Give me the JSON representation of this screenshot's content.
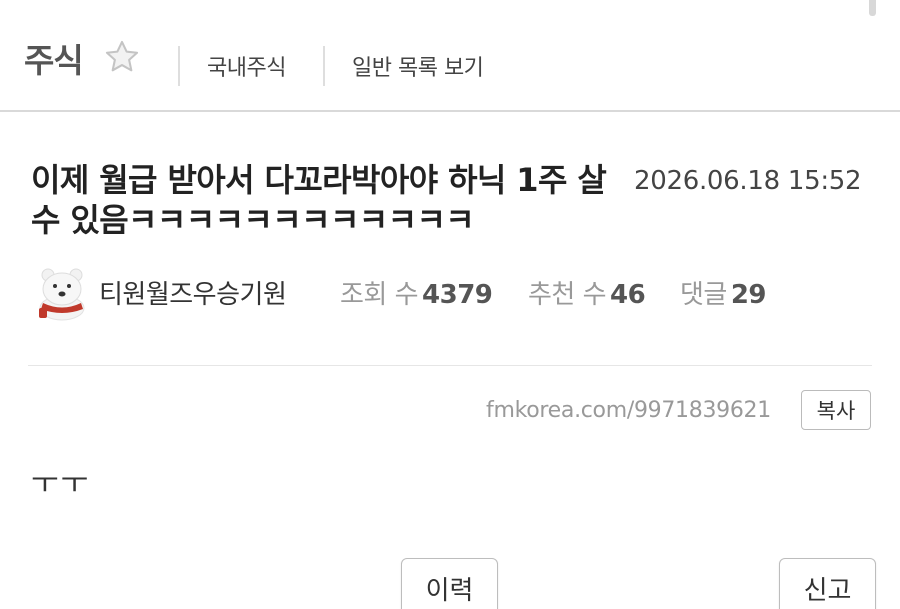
{
  "header": {
    "board_title": "주식",
    "links": [
      "국내주식",
      "일반 목록 보기"
    ]
  },
  "post": {
    "title": "이제 월급 받아서 다꼬라박아야 하닉 1주 살 수 있음ㅋㅋㅋㅋㅋㅋㅋㅋㅋㅋㅋㅋ",
    "date": "2026.06.18 15:52",
    "author": "티원월즈우승기원",
    "views_label": "조회 수",
    "views": "4379",
    "likes_label": "추천 수",
    "likes": "46",
    "comments_label": "댓글",
    "comments": "29",
    "url": "fmkorea.com/9971839621",
    "copy_label": "복사",
    "body": "ㅜㅜ"
  },
  "actions": {
    "history_label": "이력",
    "report_label": "신고"
  },
  "colors": {
    "divider": "#d9d9d9",
    "muted_text": "#999999",
    "avatar_scarf": "#c0392b"
  },
  "icons": [
    "star-icon",
    "polar-bear-avatar"
  ]
}
